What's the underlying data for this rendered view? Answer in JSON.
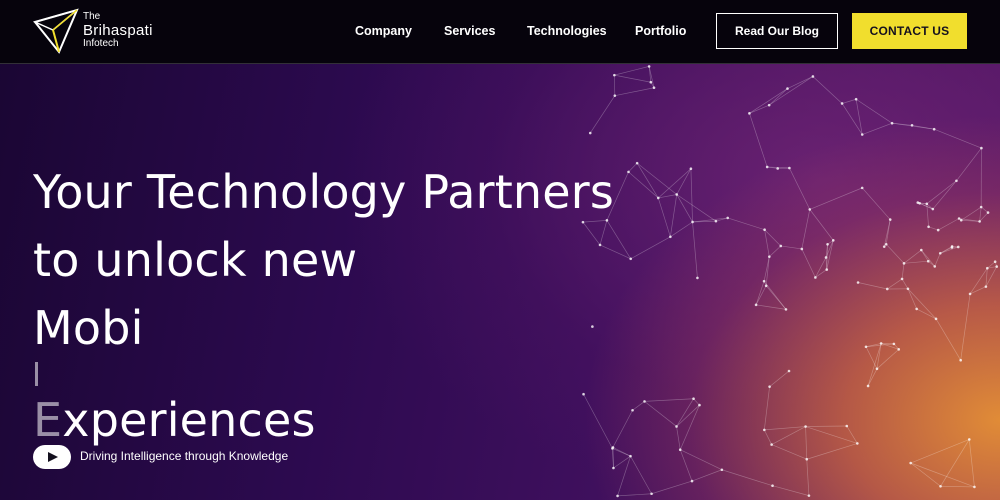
{
  "brand": {
    "line1": "The",
    "line2": "Brihaspati",
    "line3": "Infotech",
    "logo_icon": "triangle-logo-icon",
    "accent_color": "#f1de2d"
  },
  "nav": {
    "items": [
      {
        "label": "Company"
      },
      {
        "label": "Services"
      },
      {
        "label": "Technologies"
      },
      {
        "label": "Portfolio"
      }
    ],
    "blog_label": "Read Our Blog",
    "contact_label": "CONTACT US"
  },
  "hero": {
    "line1": "Your Technology Partners",
    "line2": "to unlock new",
    "line3_typed": "Mobi",
    "line3_ghost": "E",
    "line3_rest": "xperiences",
    "play_icon": "play-icon",
    "tagline": "Driving Intelligence through Knowledge"
  }
}
